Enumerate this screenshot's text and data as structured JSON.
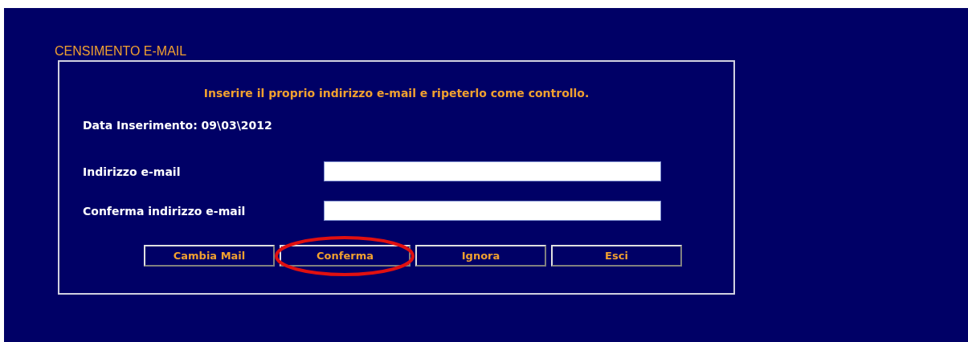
{
  "title": "CENSIMENTO E-MAIL",
  "instruction": "Inserire il proprio indirizzo e-mail e ripeterlo come controllo.",
  "date_line": "Data Inserimento: 09\\03\\2012",
  "fields": [
    {
      "label": "Indirizzo e-mail"
    },
    {
      "label": "Conferma indirizzo e-mail"
    }
  ],
  "buttons": [
    {
      "label": "Cambia Mail",
      "circled": false
    },
    {
      "label": "Conferma",
      "circled": true
    },
    {
      "label": "Ignora",
      "circled": false
    },
    {
      "label": "Esci",
      "circled": false
    }
  ]
}
